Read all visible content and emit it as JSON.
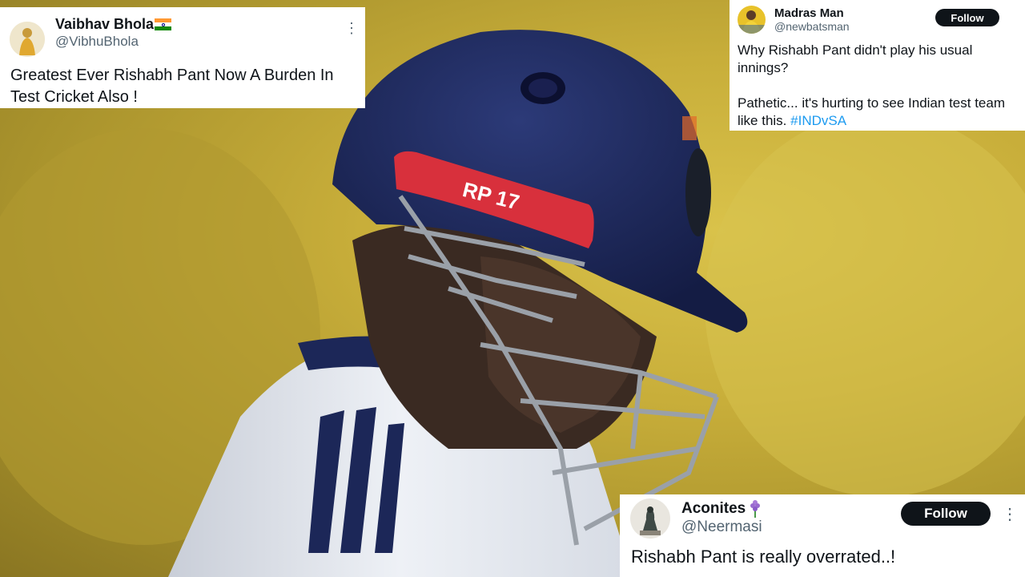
{
  "tweets": {
    "t1": {
      "name": "Vaibhav Bhola",
      "handle": "@VibhuBhola",
      "text": "Greatest Ever Rishabh Pant Now A Burden In Test Cricket Also !",
      "flag_icon": "india-flag-icon"
    },
    "t2": {
      "name": "Madras Man",
      "handle": "@newbatsman",
      "follow_label": "Follow",
      "text": "Why Rishabh Pant didn't play his usual innings?\n\nPathetic... it's hurting to see Indian test team like this. ",
      "hashtag": "#INDvSA"
    },
    "t3": {
      "name": "Aconites",
      "handle": "@Neermasi",
      "follow_label": "Follow",
      "text": "Rishabh Pant is really overrated..!",
      "emoji_icon": "hyacinth-flower-icon"
    }
  },
  "photo": {
    "helmet_label": "RP 17",
    "accent_colors": {
      "helmet": "#1c2758",
      "visor": "#d8303c",
      "background": "#c8ae3a",
      "jersey": "#eef1f6"
    }
  },
  "colors": {
    "card_bg": "#ffffff",
    "text": "#0f1419",
    "muted": "#536471",
    "link": "#1d9bf0",
    "button": "#0f1419"
  }
}
